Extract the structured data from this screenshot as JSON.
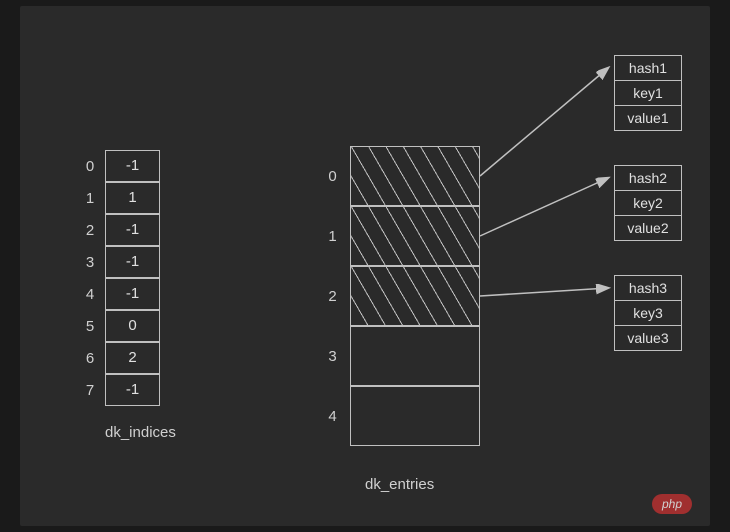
{
  "dk_indices": {
    "label": "dk_indices",
    "rows": [
      {
        "index": "0",
        "value": "-1"
      },
      {
        "index": "1",
        "value": "1"
      },
      {
        "index": "2",
        "value": "-1"
      },
      {
        "index": "3",
        "value": "-1"
      },
      {
        "index": "4",
        "value": "-1"
      },
      {
        "index": "5",
        "value": "0"
      },
      {
        "index": "6",
        "value": "2"
      },
      {
        "index": "7",
        "value": "-1"
      }
    ]
  },
  "dk_entries": {
    "label": "dk_entries",
    "rows": [
      {
        "index": "0",
        "filled": true
      },
      {
        "index": "1",
        "filled": true
      },
      {
        "index": "2",
        "filled": true
      },
      {
        "index": "3",
        "filled": false
      },
      {
        "index": "4",
        "filled": false
      }
    ]
  },
  "entry_boxes": [
    {
      "hash": "hash1",
      "key": "key1",
      "value": "value1"
    },
    {
      "hash": "hash2",
      "key": "key2",
      "value": "value2"
    },
    {
      "hash": "hash3",
      "key": "key3",
      "value": "value3"
    }
  ],
  "watermark": "php"
}
